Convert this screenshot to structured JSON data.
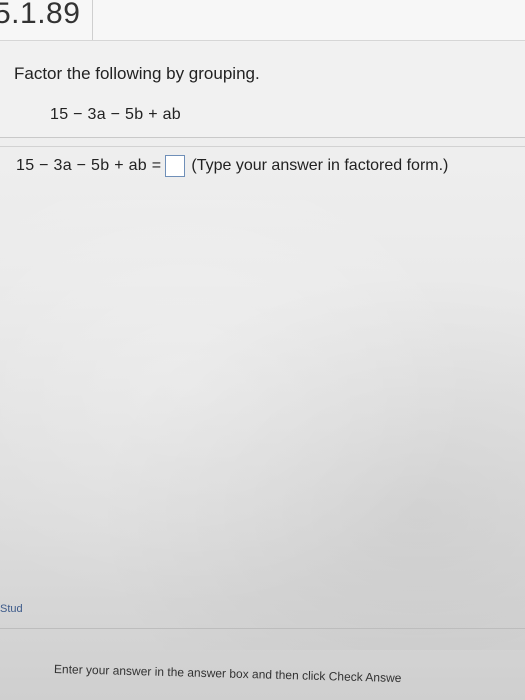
{
  "header": {
    "problem_number": "5.1.89"
  },
  "question": {
    "instruction": "Factor the following by grouping.",
    "expression": "15 − 3a − 5b + ab"
  },
  "answer": {
    "lhs": "15 − 3a − 5b + ab =",
    "input_value": "",
    "hint": "(Type your answer in factored form.)"
  },
  "sidebar": {
    "stub_label": "Stud"
  },
  "footer": {
    "instructions": "Enter your answer in the answer box and then click Check Answe"
  },
  "colors": {
    "answer_box_border": "#6f8fb8",
    "link": "#3c5a8a"
  }
}
